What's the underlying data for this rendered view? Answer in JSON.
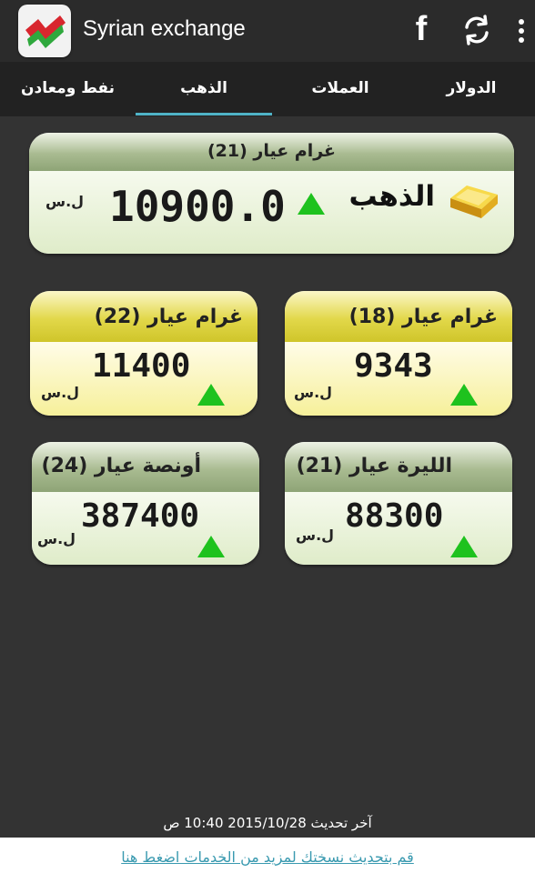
{
  "app": {
    "title": "Syrian exchange",
    "facebook_glyph": "f"
  },
  "tabs": [
    {
      "label": "الدولار"
    },
    {
      "label": "العملات"
    },
    {
      "label": "الذهب",
      "active": true
    },
    {
      "label": "نفط ومعادن"
    }
  ],
  "main_card": {
    "title": "غرام عيار (21)",
    "name": "الذهب",
    "price": "10900.0",
    "unit": "ل.س",
    "trend": "up"
  },
  "cards": [
    {
      "title": "غرام عيار (18)",
      "price": "9343",
      "unit": "ل.س",
      "trend": "up",
      "style": "yellow"
    },
    {
      "title": "غرام عيار (22)",
      "price": "11400",
      "unit": "ل.س",
      "trend": "up",
      "style": "yellow"
    },
    {
      "title": "الليرة عيار (21)",
      "price": "88300",
      "unit": "ل.س",
      "trend": "up",
      "style": "green"
    },
    {
      "title": "أونصة عيار (24)",
      "price": "387400",
      "unit": "ل.س",
      "trend": "up",
      "style": "green"
    }
  ],
  "last_update": "آخر تحديث 2015/10/28 10:40 ص",
  "footer_link": "قم بتحديث نسختك لمزيد من الخدمات اضغط هنا",
  "colors": {
    "up": "#1ec21e",
    "tab_indicator": "#4fb3c7",
    "link": "#3a9ab0"
  },
  "icons": [
    "app-logo-icon",
    "facebook-icon",
    "refresh-icon",
    "more-vert-icon",
    "gold-bar-icon",
    "up-triangle-icon"
  ]
}
